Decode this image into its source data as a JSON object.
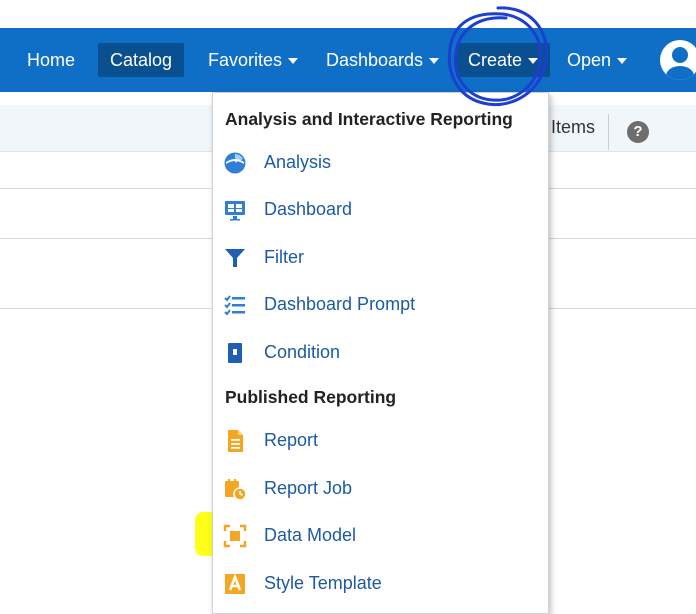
{
  "nav": {
    "home": "Home",
    "catalog": "Catalog",
    "favorites": "Favorites",
    "dashboards": "Dashboards",
    "create": "Create",
    "open": "Open"
  },
  "toolbar": {
    "items_label": "Items",
    "help_icon": "?"
  },
  "menu": {
    "section1": "Analysis and Interactive Reporting",
    "section2": "Published Reporting",
    "items": [
      {
        "label": "Analysis",
        "icon": "analysis-icon"
      },
      {
        "label": "Dashboard",
        "icon": "dashboard-icon"
      },
      {
        "label": "Filter",
        "icon": "filter-icon"
      },
      {
        "label": "Dashboard Prompt",
        "icon": "dashboard-prompt-icon"
      },
      {
        "label": "Condition",
        "icon": "condition-icon"
      },
      {
        "label": "Report",
        "icon": "report-icon"
      },
      {
        "label": "Report Job",
        "icon": "report-job-icon"
      },
      {
        "label": "Data Model",
        "icon": "data-model-icon"
      },
      {
        "label": "Style Template",
        "icon": "style-template-icon"
      }
    ]
  },
  "colors": {
    "navbar": "#0f6fc6",
    "active_tab": "#0a4f8f",
    "menu_link": "#1c5aa6",
    "highlight": "#ffff00",
    "annotation": "#1a3fd1"
  }
}
